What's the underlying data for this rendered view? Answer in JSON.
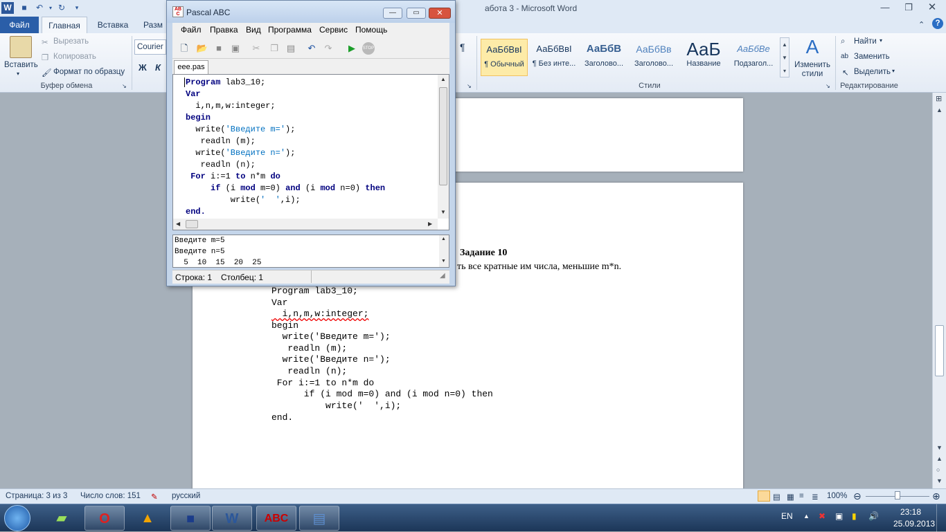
{
  "word": {
    "title": "абота 3 - Microsoft Word",
    "tabs": [
      "Файл",
      "Главная",
      "Вставка",
      "Разм"
    ],
    "clipboard": {
      "paste": "Вставить",
      "cut": "Вырезать",
      "copy": "Копировать",
      "format_painter": "Формат по образцу",
      "group_label": "Буфер обмена"
    },
    "font": {
      "name": "Courier",
      "bold": "Ж",
      "italic": "К"
    },
    "styles": {
      "items": [
        {
          "preview": "АаБбВвI",
          "name": "¶ Обычный"
        },
        {
          "preview": "АаБбВвI",
          "name": "¶ Без инте..."
        },
        {
          "preview": "АаБбВ",
          "name": "Заголово..."
        },
        {
          "preview": "АаБбВв",
          "name": "Заголово..."
        },
        {
          "preview": "АаБ",
          "name": "Название"
        },
        {
          "preview": "АаБбВе",
          "name": "Подзагол..."
        }
      ],
      "change_styles": "Изменить стили",
      "group_label": "Стили"
    },
    "editing": {
      "find": "Найти",
      "replace": "Заменить",
      "select": "Выделить",
      "group_label": "Редактирование"
    },
    "paragraph_mark": "¶",
    "document": {
      "heading": "Задание 10",
      "subtitle": "ть все кратные им числа, меньшие m*n.",
      "code": [
        "Program lab3_10;",
        "Var",
        "  i,n,m,w:integer;",
        "begin",
        "  write('Введите m=');",
        "   readln (m);",
        "  write('Введите n=');",
        "   readln (n);",
        " For i:=1 to n*m do",
        "      if (i mod m=0) and (i mod n=0) then",
        "          write('  ',i);",
        "end."
      ]
    },
    "status": {
      "page": "Страница: 3 из 3",
      "words": "Число слов: 151",
      "language": "русский",
      "zoom": "100%"
    }
  },
  "pascal": {
    "title": "Pascal ABC",
    "menu": [
      "Файл",
      "Правка",
      "Вид",
      "Программа",
      "Сервис",
      "Помощь"
    ],
    "tab": "eee.pas",
    "code_lines": [
      {
        "kw": "Program",
        "rest": " lab3_10;"
      },
      {
        "kw": "Var",
        "rest": ""
      },
      {
        "kw": "",
        "rest": "  i,n,m,w:integer;"
      },
      {
        "kw": "begin",
        "rest": ""
      }
    ],
    "output": [
      "Введите m=5",
      "Введите n=5",
      "  5  10  15  20  25"
    ],
    "status": {
      "line": "Строка: 1",
      "column": "Столбец: 1"
    }
  },
  "taskbar": {
    "lang": "EN",
    "time": "23:18",
    "date": "25.09.2013"
  }
}
